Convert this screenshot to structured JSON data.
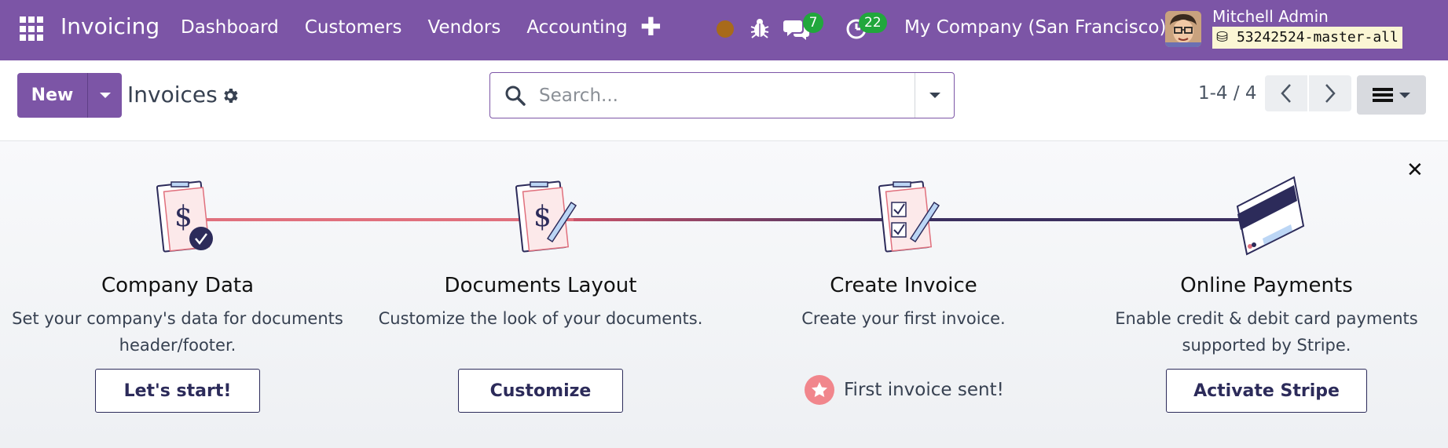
{
  "navbar": {
    "app_name": "Invoicing",
    "menu": [
      "Dashboard",
      "Customers",
      "Vendors",
      "Accounting"
    ],
    "chat_count": "7",
    "activity_count": "22",
    "company": "My Company (San Francisco)",
    "user_name": "Mitchell Admin",
    "database": "53242524-master-all",
    "colors": {
      "brand": "#7c55a6",
      "badge": "#21a73c",
      "status_dot": "#a86a1a"
    }
  },
  "control_panel": {
    "new_label": "New",
    "title": "Invoices",
    "search_placeholder": "Search...",
    "pager": "1-4 / 4"
  },
  "onboarding": {
    "steps": [
      {
        "title": "Company Data",
        "description": "Set your company's data for documents header/footer.",
        "button": "Let's start!"
      },
      {
        "title": "Documents Layout",
        "description": "Customize the look of your documents.",
        "button": "Customize"
      },
      {
        "title": "Create Invoice",
        "description": "Create your first invoice.",
        "done_label": "First invoice sent!"
      },
      {
        "title": "Online Payments",
        "description": "Enable credit & debit card payments supported by Stripe.",
        "button": "Activate Stripe"
      }
    ],
    "colors": {
      "line_done": "#e0707d",
      "line_pending": "#3b2f5f",
      "accent": "#2c2b5a"
    }
  }
}
